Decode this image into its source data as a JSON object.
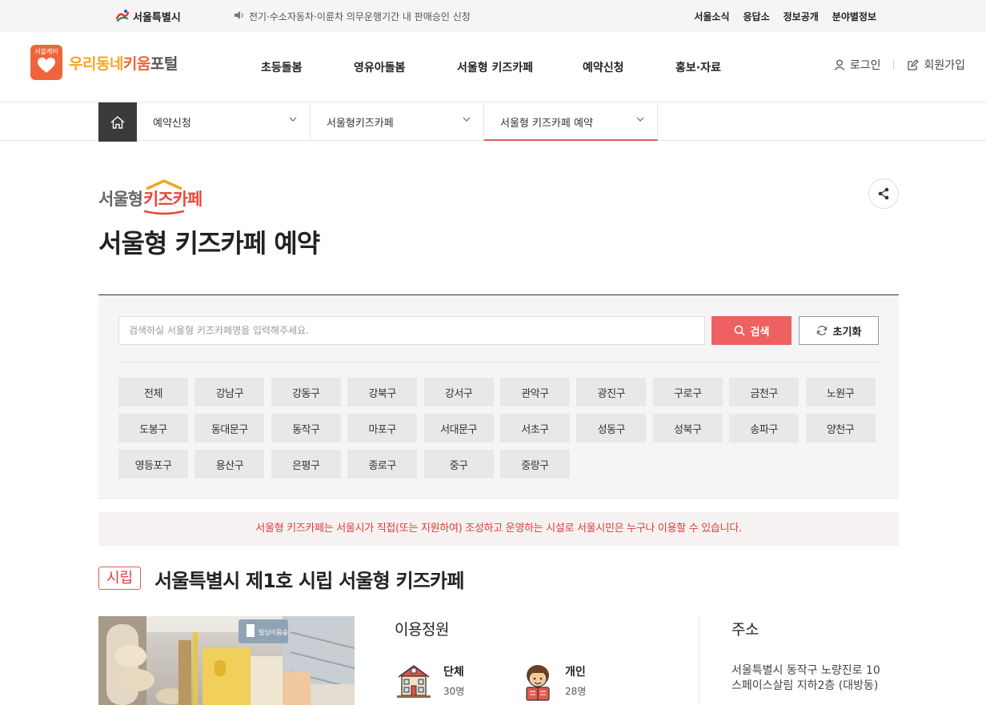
{
  "topbar": {
    "seoul_logo": "서울특별시",
    "notice": "전기·수소자동차·이륜차 의무운행기간 내 판매승인 신청",
    "links": [
      "서울소식",
      "응답소",
      "정보공개",
      "분야별정보"
    ]
  },
  "header": {
    "brand_badge": "서울케어",
    "brand_name_1": "우리동네",
    "brand_name_2": "키움",
    "brand_name_3": "포털",
    "gnb": [
      "초등돌봄",
      "영유아돌봄",
      "서울형 키즈카페",
      "예약신청",
      "홍보·자료"
    ],
    "login": "로그인",
    "signup": "회원가입"
  },
  "location": {
    "items": [
      "예약신청",
      "서울형키즈카페",
      "서울형 키즈카페 예약"
    ]
  },
  "page": {
    "logo_text_1": "서울형",
    "logo_text_2": "키즈카페",
    "title": "서울형 키즈카페 예약"
  },
  "search": {
    "placeholder": "검색하실 서울형 키즈카페명을 입력해주세요.",
    "search_label": "검색",
    "reset_label": "초기화"
  },
  "districts": [
    "전체",
    "강남구",
    "강동구",
    "강북구",
    "강서구",
    "관악구",
    "광진구",
    "구로구",
    "금천구",
    "노원구",
    "도봉구",
    "동대문구",
    "동작구",
    "마포구",
    "서대문구",
    "서초구",
    "성동구",
    "성북구",
    "송파구",
    "양천구",
    "영등포구",
    "용산구",
    "은평구",
    "종로구",
    "중구",
    "중랑구"
  ],
  "info_bar": "서울형 키즈카페는 서울시가 직접(또는 지원하여) 조성하고 운영하는 시설로 서울시민은 누구나 이용할 수 있습니다.",
  "facility": {
    "badge": "시립",
    "title": "서울특별시 제1호 시립 서울형 키즈카페",
    "capacity_title": "이용정원",
    "group_label": "단체",
    "group_count": "30명",
    "individual_label": "개인",
    "individual_count": "28명",
    "address_title": "주소",
    "address_line1": "서울특별시 동작구 노량진로 10",
    "address_line2": "스페이스살림 지하2층 (대방동)",
    "photo_sign": "빌딩이룸숲"
  },
  "colors": {
    "accent": "#ee6161",
    "brand_orange": "#f0643c",
    "brand_yellow": "#f5a623",
    "home_bg": "#3a3a3a",
    "notice_red": "#e03c3c"
  }
}
